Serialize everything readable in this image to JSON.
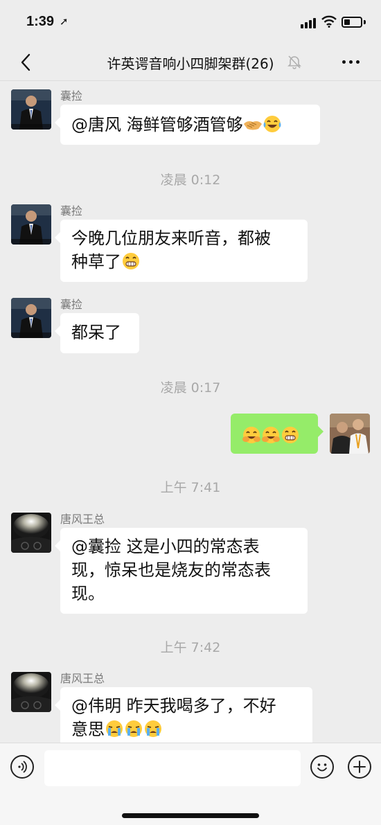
{
  "status": {
    "time": "1:39",
    "battery_level": 0.35
  },
  "header": {
    "title": "许英谔音响小四脚架群(26)"
  },
  "messages": [
    {
      "type": "msg",
      "side": "left",
      "sender": "囊捡",
      "avatar": "man-in-suit",
      "text": "@唐风 海鲜管够酒管够",
      "emojis": [
        "handshake",
        "tears-of-joy"
      ]
    },
    {
      "type": "time",
      "text": "凌晨 0:12"
    },
    {
      "type": "msg",
      "side": "left",
      "sender": "囊捡",
      "avatar": "man-in-suit",
      "line1": "今晚几位朋友来听音，都被",
      "line2": "种草了",
      "emojis": [
        "grin"
      ]
    },
    {
      "type": "msg",
      "side": "left",
      "sender": "囊捡",
      "avatar": "man-in-suit",
      "text": "都呆了"
    },
    {
      "type": "time",
      "text": "凌晨 0:17"
    },
    {
      "type": "msg",
      "side": "right",
      "avatar": "two-men",
      "emojis": [
        "laugh-cry",
        "laugh-cry",
        "grin"
      ]
    },
    {
      "type": "time",
      "text": "上午 7:41"
    },
    {
      "type": "msg",
      "side": "left",
      "sender": "唐风王总",
      "avatar": "car-headlights",
      "line1": "@囊捡 这是小四的常态表",
      "line2": "现，惊呆也是烧友的常态表",
      "line3": "现。"
    },
    {
      "type": "time",
      "text": "上午 7:42"
    },
    {
      "type": "msg",
      "side": "left",
      "sender": "唐风王总",
      "avatar": "car-headlights",
      "line1": "@伟明 昨天我喝多了，不好",
      "line2": "意思",
      "emojis": [
        "crying",
        "crying",
        "crying"
      ]
    }
  ],
  "input": {
    "value": "",
    "placeholder": ""
  },
  "icons": {
    "back": "chevron-left-icon",
    "mute": "bell-off-icon",
    "more": "more-dots-icon",
    "voice": "voice-icon",
    "emoji": "emoji-face-icon",
    "add": "plus-icon"
  },
  "colors": {
    "background": "#ededed",
    "bubble_left": "#ffffff",
    "bubble_right": "#95ec69",
    "timestamp": "#a8a8a8"
  }
}
